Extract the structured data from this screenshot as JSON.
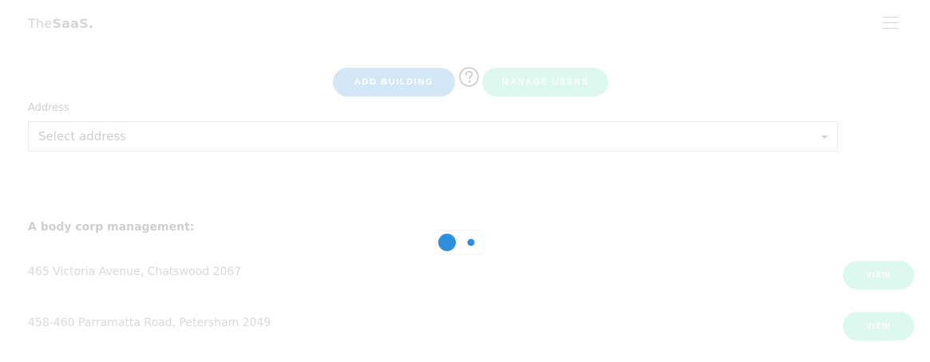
{
  "header": {
    "logo_light": "The",
    "logo_bold": "SaaS",
    "logo_dot": ".",
    "menu_icon": "hamburger-icon"
  },
  "actions": {
    "add_building_label": "ADD BUILDING",
    "help_icon": "question-circle-icon",
    "manage_users_label": "MANAGE USERS"
  },
  "address": {
    "label": "Address",
    "placeholder": "Select address",
    "dropdown_icon": "chevron-down-icon"
  },
  "buildings_section": {
    "title": "A body corp management:",
    "items": [
      {
        "address": "465 Victoria Avenue, Chatswood 2067",
        "action_label": "VIEW"
      },
      {
        "address": "458-460 Parramatta Road, Petersham 2049",
        "action_label": "VIEW"
      }
    ]
  },
  "loader": {
    "icon": "loading-spinner-icon",
    "color": "#2f8fdd"
  },
  "colors": {
    "primary_pale": "#d3e7f7",
    "success_pale": "#dcf8ef",
    "muted_text": "#cfcfcf"
  }
}
